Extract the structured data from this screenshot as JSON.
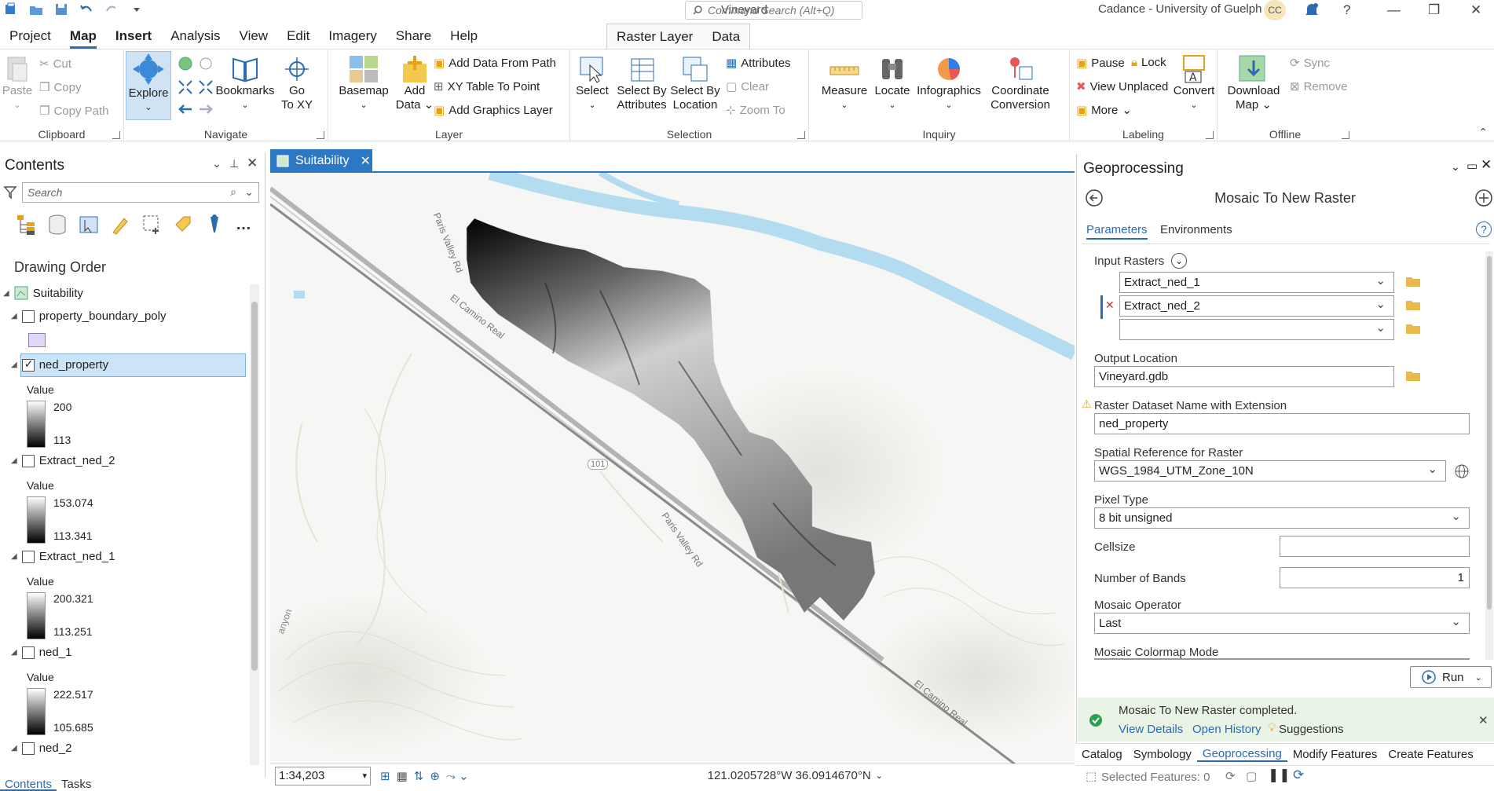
{
  "app": {
    "title": "Vineyard",
    "command_search_placeholder": "Command Search (Alt+Q)",
    "user": "Cadance - University of Guelph",
    "avatar_initials": "CC"
  },
  "menu_tabs": [
    "Project",
    "Map",
    "Insert",
    "Analysis",
    "View",
    "Edit",
    "Imagery",
    "Share",
    "Help"
  ],
  "context_tabs": [
    "Raster Layer",
    "Data"
  ],
  "ribbon": {
    "clipboard": {
      "label": "Clipboard",
      "paste": "Paste",
      "cut": "Cut",
      "copy": "Copy",
      "copy_path": "Copy Path"
    },
    "navigate": {
      "label": "Navigate",
      "explore": "Explore",
      "bookmarks": "Bookmarks",
      "go_to_xy_1": "Go",
      "go_to_xy_2": "To XY"
    },
    "layer": {
      "label": "Layer",
      "basemap": "Basemap",
      "add_data_1": "Add",
      "add_data_2": "Data",
      "add_data_from_path": "Add Data From Path",
      "xy_table_to_point": "XY Table To Point",
      "add_graphics_layer": "Add Graphics Layer"
    },
    "selection": {
      "label": "Selection",
      "select": "Select",
      "select_by_attributes_1": "Select By",
      "select_by_attributes_2": "Attributes",
      "select_by_location_1": "Select By",
      "select_by_location_2": "Location",
      "attributes": "Attributes",
      "clear": "Clear",
      "zoom_to": "Zoom To"
    },
    "inquiry": {
      "label": "Inquiry",
      "measure": "Measure",
      "locate": "Locate",
      "infographics": "Infographics",
      "coordinate_conversion_1": "Coordinate",
      "coordinate_conversion_2": "Conversion"
    },
    "labeling": {
      "label": "Labeling",
      "pause": "Pause",
      "lock": "Lock",
      "view_unplaced": "View Unplaced",
      "more": "More",
      "convert": "Convert"
    },
    "offline": {
      "label": "Offline",
      "download_map_1": "Download",
      "download_map_2": "Map",
      "sync": "Sync",
      "remove": "Remove"
    }
  },
  "contents": {
    "title": "Contents",
    "search_placeholder": "Search",
    "drawing_order": "Drawing Order",
    "map_name": "Suitability",
    "layers": [
      {
        "name": "property_boundary_poly",
        "checked": false
      },
      {
        "name": "ned_property",
        "checked": true,
        "value_label": "Value",
        "max": "200",
        "min": "113"
      },
      {
        "name": "Extract_ned_2",
        "checked": false,
        "value_label": "Value",
        "max": "153.074",
        "min": "113.341"
      },
      {
        "name": "Extract_ned_1",
        "checked": false,
        "value_label": "Value",
        "max": "200.321",
        "min": "113.251"
      },
      {
        "name": "ned_1",
        "checked": false,
        "value_label": "Value",
        "max": "222.517",
        "min": "105.685"
      },
      {
        "name": "ned_2",
        "checked": false
      }
    ],
    "bottom_tabs": [
      "Contents",
      "Tasks"
    ]
  },
  "map": {
    "tab_name": "Suitability",
    "scale": "1:34,203",
    "coordinates": "121.0205728°W 36.0914670°N",
    "labels": {
      "paris_valley_rd_1": "Paris Valley Rd",
      "el_camino_real_1": "El Camino Real",
      "route_101": "101",
      "paris_valley_rd_2": "Paris Valley Rd",
      "el_camino_real_2": "El Camino Real",
      "canyon": "anyon"
    }
  },
  "geoprocessing": {
    "title": "Geoprocessing",
    "tool_name": "Mosaic To New Raster",
    "tabs": [
      "Parameters",
      "Environments"
    ],
    "input_rasters_label": "Input Rasters",
    "input_rasters": [
      "Extract_ned_1",
      "Extract_ned_2",
      ""
    ],
    "output_location_label": "Output Location",
    "output_location": "Vineyard.gdb",
    "dataset_name_label": "Raster Dataset Name with Extension",
    "dataset_name": "ned_property",
    "spatial_ref_label": "Spatial Reference for  Raster",
    "spatial_ref": "WGS_1984_UTM_Zone_10N",
    "pixel_type_label": "Pixel Type",
    "pixel_type": "8 bit unsigned",
    "cellsize_label": "Cellsize",
    "cellsize": "",
    "bands_label": "Number of Bands",
    "bands": "1",
    "mosaic_operator_label": "Mosaic Operator",
    "mosaic_operator": "Last",
    "colormap_label": "Mosaic Colormap Mode",
    "run": "Run",
    "success_msg": "Mosaic To New Raster completed.",
    "view_details": "View Details",
    "open_history": "Open History",
    "suggestions": "Suggestions",
    "bottom_tabs": [
      "Catalog",
      "Symbology",
      "Geoprocessing",
      "Modify Features",
      "Create Features"
    ],
    "selected_features": "Selected Features: 0"
  },
  "colors": {
    "accent": "#2b6cb0",
    "map_tab": "#2b78c5",
    "success_bg": "#e9f3e6",
    "water": "#b4dcf0"
  }
}
